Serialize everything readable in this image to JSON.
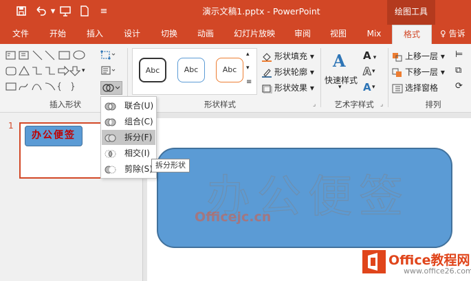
{
  "titlebar": {
    "title": "演示文稿1.pptx - PowerPoint",
    "context_tab_group": "绘图工具",
    "qat": [
      "save-icon",
      "undo-icon",
      "present-icon",
      "new-icon",
      "customize-icon"
    ]
  },
  "tabs": [
    {
      "label": "文件"
    },
    {
      "label": "开始"
    },
    {
      "label": "插入"
    },
    {
      "label": "设计"
    },
    {
      "label": "切换"
    },
    {
      "label": "动画"
    },
    {
      "label": "幻灯片放映"
    },
    {
      "label": "审阅"
    },
    {
      "label": "视图"
    },
    {
      "label": "Mix"
    },
    {
      "label": "格式",
      "active": true
    },
    {
      "label": "告诉"
    }
  ],
  "ribbon": {
    "groups": {
      "insert_shapes": "插入形状",
      "shape_styles": "形状样式",
      "art_text_styles": "艺术字样式",
      "arrange": "排列"
    },
    "style_presets": [
      "Abc",
      "Abc",
      "Abc"
    ],
    "shape_fill": "形状填充",
    "shape_outline": "形状轮廓",
    "shape_effects": "形状效果",
    "quick_styles": "快速样式",
    "bring_forward": "上移一层",
    "send_backward": "下移一层",
    "selection_pane": "选择窗格"
  },
  "merge_menu": {
    "items": [
      {
        "label": "联合(U)"
      },
      {
        "label": "组合(C)"
      },
      {
        "label": "拆分(F)",
        "highlighted": true
      },
      {
        "label": "相交(I)"
      },
      {
        "label": "剪除(S)"
      }
    ],
    "tooltip": "拆分形状"
  },
  "thumbnail": {
    "number": "1",
    "shape_text": "办公便签"
  },
  "slide": {
    "shape_text": "办公便签"
  },
  "watermarks": {
    "officejc": "Officejc.cn",
    "office_net": "Office教程网",
    "office_url": "www.office26.com"
  },
  "colors": {
    "accent": "#d24726",
    "shape_fill": "#5b9bd5",
    "shape_border": "#41719c",
    "thumb_text": "#c00000"
  }
}
